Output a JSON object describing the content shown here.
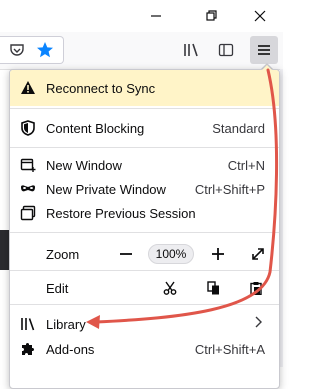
{
  "toolbar": {
    "pocket_icon": "pocket-icon",
    "bookmark_star_icon": "star-filled-icon",
    "library_icon": "library-icon",
    "sidebar_icon": "sidebar-icon",
    "menu_icon": "hamburger-icon"
  },
  "panel": {
    "sync": {
      "label": "Reconnect to Sync",
      "icon": "warning-icon"
    },
    "content_blocking": {
      "label": "Content Blocking",
      "value": "Standard",
      "icon": "shield-icon"
    },
    "new_window": {
      "label": "New Window",
      "shortcut": "Ctrl+N",
      "icon": "new-window-icon"
    },
    "private_window": {
      "label": "New Private Window",
      "shortcut": "Ctrl+Shift+P",
      "icon": "private-mask-icon"
    },
    "restore_session": {
      "label": "Restore Previous Session",
      "icon": "restore-session-icon"
    },
    "zoom": {
      "label": "Zoom",
      "value": "100%",
      "minus": "−",
      "plus": "+"
    },
    "edit": {
      "label": "Edit"
    },
    "library": {
      "label": "Library",
      "icon": "library-icon"
    },
    "addons": {
      "label": "Add-ons",
      "shortcut": "Ctrl+Shift+A",
      "icon": "puzzle-icon"
    }
  },
  "colors": {
    "annotation_arrow": "#e0564a",
    "sync_background": "#fff4c8",
    "accent_blue": "#0a84ff"
  }
}
